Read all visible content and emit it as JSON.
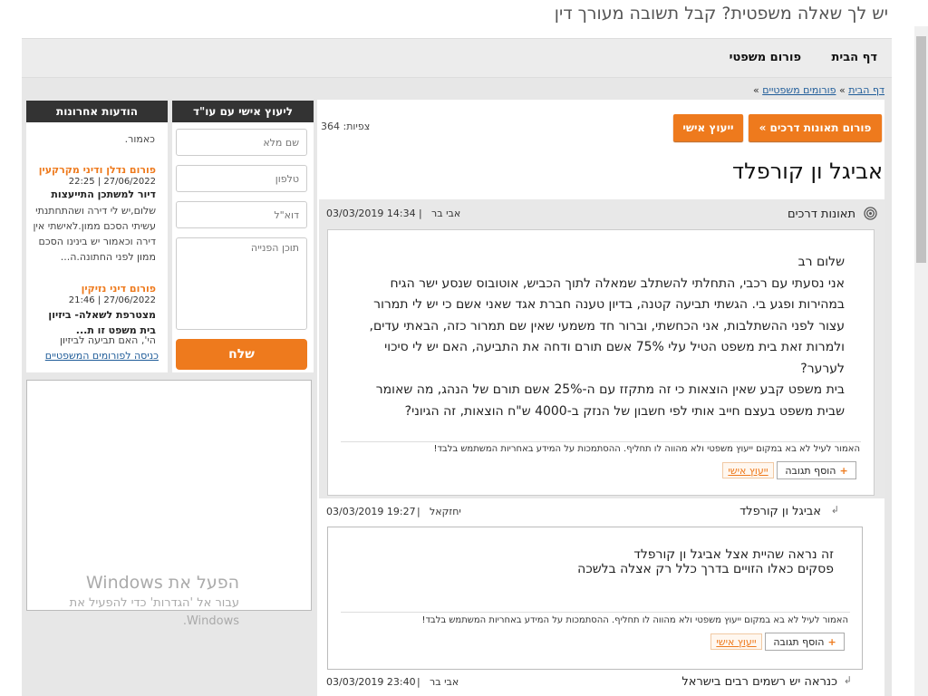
{
  "header": {
    "tagline": "יש לך שאלה משפטית? קבל תשובה מעורך דין"
  },
  "nav": {
    "home": "דף הבית",
    "legal_forum": "פורום משפטי"
  },
  "breadcrumb": {
    "home": "דף הבית",
    "sep": "»",
    "forums": "פורומים משפטיים",
    "end": "»"
  },
  "toolbar": {
    "back_forum": "« פורום תאונות דרכים",
    "personal_advice": "ייעוץ אישי",
    "views": "צפיות: 364"
  },
  "thread": {
    "title": "אביגל ון קורפלד"
  },
  "post1": {
    "title": "תאונות דרכים",
    "author": "אבי בר",
    "separator": "|",
    "datetime": "03/03/2019 14:34",
    "greeting": "שלום רב",
    "paragraph1": "אני נסעתי עם רכבי, התחלתי להשתלב שמאלה לתוך הכביש, אוטובוס שנסע ישר הגיח במהירות ופגע בי. הגשתי תביעה קטנה, בדיון טענה חברת אגד שאני אשם כי יש לי תמרור עצור לפני ההשתלבות, אני הכחשתי, וברור חד משמעי שאין שם תמרור כזה, הבאתי עדים, ולמרות זאת בית משפט הטיל עלי 75% אשם תורם ודחה את התביעה, האם יש לי סיכוי לערער?",
    "paragraph2": "בית משפט קבע שאין הוצאות כי זה מתקזז עם ה-25% אשם תורם של הנהג, מה שאומר שבית משפט בעצם חייב אותי לפי חשבון של הנזק ב-4000 ש\"ח הוצאות, זה הגיוני?",
    "disclaimer": "האמור לעיל לא בא במקום ייעוץ משפטי ולא מהווה לו תחליף. ההסתמכות על המידע באחריות המשתמש בלבד!",
    "add_reply": "הוסף תגובה",
    "personal_advice": "ייעוץ אישי"
  },
  "reply1": {
    "title": "אביגל ון קורפלד",
    "author": "יחזקאל",
    "separator": "|",
    "datetime": "03/03/2019 19:27",
    "line1": "זה נראה שהיית אצל אביגל ון קורפלד",
    "line2": "פסקים כאלו הזויים בדרך כלל רק אצלה בלשכה",
    "disclaimer": "האמור לעיל לא בא במקום ייעוץ משפטי ולא מהווה לו תחליף. ההסתמכות על המידע באחריות המשתמש בלבד!",
    "add_reply": "הוסף תגובה",
    "personal_advice": "ייעוץ אישי"
  },
  "reply2": {
    "title": "כנראה יש רשמים רבים בישראל",
    "author": "אבי בר",
    "separator": "|",
    "datetime": "03/03/2019 23:40"
  },
  "contact_form": {
    "heading": "ליעוץ אישי עם עו\"ד",
    "full_name": "שם מלא",
    "phone": "טלפון",
    "email": "דוא\"ל",
    "message": "תוכן הפנייה",
    "send": "שלח"
  },
  "recent_posts": {
    "heading": "הודעות אחרונות",
    "top_snippet": "כאמור.",
    "items": [
      {
        "forum": "פורום נדלן ודיני מקרקעין",
        "date": "27/06/2022",
        "sep": "|",
        "time": "22:25",
        "title": "דיור למשתכן התייעצות",
        "body": "שלום,יש לי דירה ושהתחתנתי עשיתי הסכם ממון.לאישתי אין דירה וכאמור יש בינינו הסכם ממון לפני החתונה.ה..."
      },
      {
        "forum": "פורום דיני נזיקין",
        "date": "27/06/2022",
        "sep": "|",
        "time": "21:46",
        "title": "מצטרפת לשאלה- ביזיון בית משפט זו ת...",
        "body": "הי', האם תביעה לביזיון"
      }
    ],
    "enter_link": "כניסה לפורומים המשפטיים"
  },
  "watermark": {
    "line1": "הפעל את Windows",
    "line2": "עבור אל 'הגדרות' כדי להפעיל את Windows."
  },
  "colors": {
    "accent": "#ee7a1d",
    "header_dark": "#333333",
    "link": "#1f5c99"
  },
  "icons": {
    "post_icon": "target-icon",
    "reply_icon": "reply-arrow-icon",
    "add_icon": "plus-icon"
  }
}
